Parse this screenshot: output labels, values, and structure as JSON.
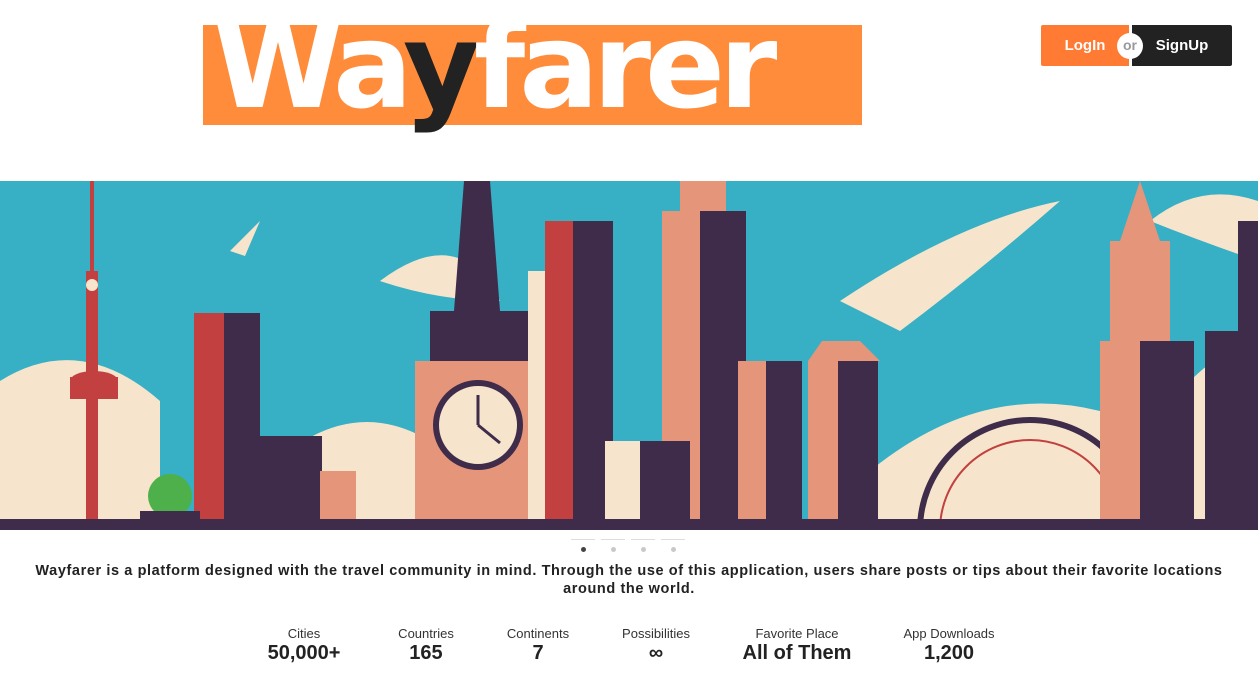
{
  "header": {
    "logo_text_left": "Wa",
    "logo_text_mid": "y",
    "logo_text_right": "farer",
    "login_label": "LogIn",
    "or_label": "or",
    "signup_label": "SignUp"
  },
  "carousel": {
    "slide_count": 4,
    "active_index": 0
  },
  "description": "Wayfarer is a platform designed with the travel community in mind. Through the use of this application, users share posts or tips about their favorite locations around the world.",
  "stats": [
    {
      "label": "Cities",
      "value": "50,000+"
    },
    {
      "label": "Countries",
      "value": "165"
    },
    {
      "label": "Continents",
      "value": "7"
    },
    {
      "label": "Possibilities",
      "value": "∞"
    },
    {
      "label": "Favorite Place",
      "value": "All of Them"
    },
    {
      "label": "App Downloads",
      "value": "1,200"
    }
  ],
  "colors": {
    "brand_orange": "#FF8C3B",
    "dark": "#222222",
    "sky": "#37AFC4"
  }
}
